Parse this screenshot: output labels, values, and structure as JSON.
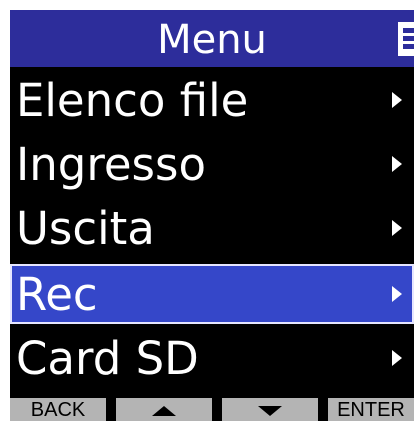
{
  "header": {
    "title": "Menu",
    "battery_icon": "battery-icon"
  },
  "menu": {
    "items": [
      {
        "label": "Elenco file",
        "icon": "chevron-right-icon",
        "selected": false
      },
      {
        "label": "Ingresso",
        "icon": "chevron-right-icon",
        "selected": false
      },
      {
        "label": "Uscita",
        "icon": "chevron-right-icon",
        "selected": false
      },
      {
        "label": "Rec",
        "icon": "chevron-right-icon",
        "selected": true
      },
      {
        "label": "Card SD",
        "icon": "chevron-right-icon",
        "selected": false
      }
    ]
  },
  "softkeys": {
    "back": "BACK",
    "up_icon": "triangle-up-icon",
    "down_icon": "triangle-down-icon",
    "enter": "ENTER"
  },
  "colors": {
    "title_bar": "#2d2d9b",
    "selection": "#3547c9",
    "background": "#000000",
    "softkey": "#b4b4b4"
  }
}
